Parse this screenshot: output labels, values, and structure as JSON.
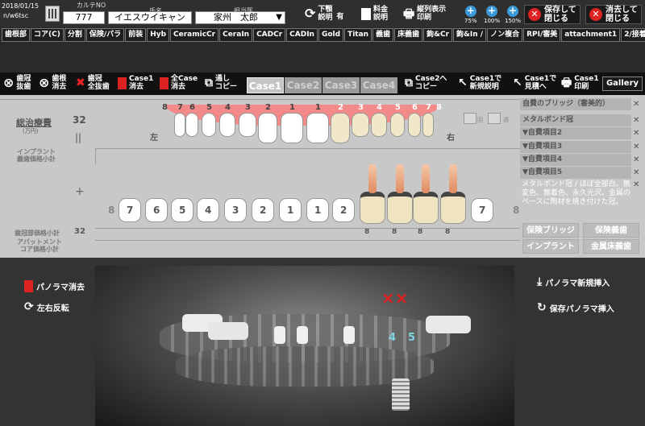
{
  "header": {
    "date": "2018/01/15",
    "code": "n/w6tsc",
    "karte_label": "カルテNO",
    "karte_value": "777",
    "name_label": "氏名",
    "name_value": "イエスウイキャン",
    "doctor_label": "担当医",
    "doctor_value": "家州　太郎",
    "shitaga_label": "下顎\n説明",
    "shitaga_state": "有",
    "fee_label": "料金\n説明",
    "print_label": "縦列表示\n印刷",
    "zoom_75": "75%",
    "zoom_100": "100%",
    "zoom_150": "150%",
    "save_close_label": "保存して\n閉じる",
    "delete_close_label": "消去して\n閉じる"
  },
  "tabs": [
    "歯根部",
    "コア(C)",
    "分割",
    "保険/パラ",
    "前装",
    "Hyb",
    "CeramicCr",
    "CeraIn",
    "CADCr",
    "CADIn",
    "Gold",
    "Titan",
    "義歯",
    "床義歯",
    "鉤&Cr",
    "鉤&In /",
    "ノン複合",
    "RPI/審美",
    "attachment1",
    "2/接着"
  ],
  "actions": {
    "crown_extract": "歯冠\n抜歯",
    "root_delete": "歯根\n消去",
    "crown_all_extract": "歯冠\n全抜歯",
    "case1_delete": "Case1\n消去",
    "all_case_delete": "全Case\n消去",
    "copy_all": "通し\nコピー",
    "case2_copy": "Case2へ\nコピー",
    "case1_new": "Case1で\n新規説明",
    "case1_estimate": "Case1で\n見積へ",
    "case1_print": "Case1\n印刷",
    "gallery": "Gallery"
  },
  "cases": [
    "Case1",
    "Case2",
    "Case3",
    "Case4"
  ],
  "chart": {
    "total_label": "総治療費",
    "total_unit": "(万円)",
    "total_value": "32",
    "equals": "||",
    "left_label": "左",
    "right_label": "右",
    "implant_label": "インプラント\n義歯価格小計",
    "plus": "+",
    "crown_label": "歯冠部価格小計",
    "crown_value": "32",
    "abutment_label": "アバットメント\nコア価格小計",
    "upper_numbers": [
      "8",
      "7",
      "6",
      "5",
      "4",
      "3",
      "2",
      "1",
      "1",
      "2",
      "3",
      "4",
      "5",
      "6",
      "7",
      "8"
    ],
    "lower_numbers": [
      "8",
      "7",
      "6",
      "5",
      "4",
      "3",
      "2",
      "1",
      "1",
      "2",
      "",
      "",
      "",
      "",
      "7",
      "8"
    ],
    "lower_bottom_marks": [
      "8",
      "8",
      "8",
      "8"
    ],
    "kai_label": "回",
    "ryo_label": "週"
  },
  "right_panel": {
    "items": [
      "自費のブリッジ（審美的）",
      "メタルボンド冠",
      "▼自費項目2",
      "▼自費項目3",
      "▼自費項目4",
      "▼自費項目5"
    ],
    "description": "メタルボンド冠 / ほぼ全部白。無変色、無着色、永久光沢。金属のベースに陶材を焼き付けた冠。",
    "btn_hoken_bridge": "保険ブリッジ",
    "btn_hoken_gishi": "保険義歯",
    "btn_implant": "インプラント",
    "btn_kinzoku": "金属床義歯"
  },
  "xray": {
    "delete_label": "パノラマ消去",
    "flip_label": "左右反転",
    "new_insert_label": "パノラマ新規挿入",
    "save_insert_label": "保存パノラマ挿入",
    "mark_x": "××",
    "num_4": "4",
    "num_5": "5"
  },
  "colors": {
    "accent_blue": "#3a9ad9",
    "danger_red": "#d22222",
    "gum_pink": "#f28a8a",
    "teal_num": "#7fd3e0"
  }
}
